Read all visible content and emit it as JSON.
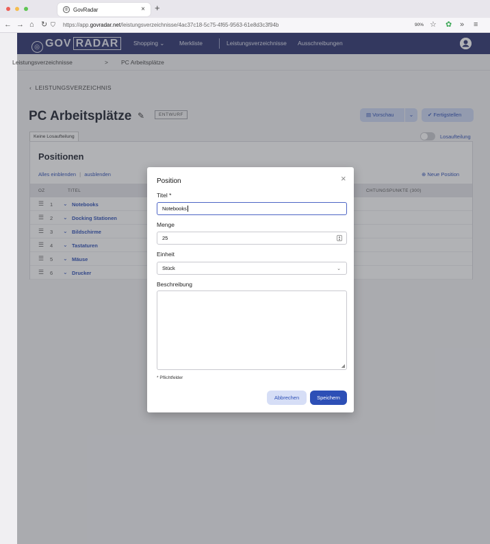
{
  "browser": {
    "tab_title": "GovRadar",
    "tab_close": "×",
    "new_tab": "+",
    "url_prefix": "https://app.",
    "url_host": "govradar.net",
    "url_path": "/leistungsverzeichnisse/4ac37c18-5c75-4f65-9563-61e8d3c3f94b",
    "zoom": "90%"
  },
  "nav": {
    "logo_left": "GOV",
    "logo_right": "RADAR",
    "shopping": "Shopping",
    "merkliste": "Merkliste",
    "leistungsverzeichnisse": "Leistungsverzeichnisse",
    "ausschreibungen": "Ausschreibungen"
  },
  "breadcrumb": {
    "root": "Leistungsverzeichnisse",
    "sep": ">",
    "current": "PC Arbeitsplätze"
  },
  "page": {
    "back_link": "LEISTUNGSVERZEICHNIS",
    "title": "PC Arbeitsplätze",
    "status_badge": "ENTWURF",
    "preview_button": "Vorschau",
    "finish_button": "Fertigstellen",
    "lot_tab": "Keine Losaufteilung",
    "lot_toggle_label": "Losaufteilung"
  },
  "positions": {
    "heading": "Positionen",
    "show_all": "Alles einblenden",
    "divider": "|",
    "hide_all": "ausblenden",
    "new_position": "Neue Position",
    "col_oz": "OZ",
    "col_title": "TITEL",
    "col_points": "CHTUNGSPUNKTE (300)",
    "rows": [
      {
        "oz": "1",
        "title": "Notebooks"
      },
      {
        "oz": "2",
        "title": "Docking Stationen"
      },
      {
        "oz": "3",
        "title": "Bildschirme"
      },
      {
        "oz": "4",
        "title": "Tastaturen"
      },
      {
        "oz": "5",
        "title": "Mäuse"
      },
      {
        "oz": "6",
        "title": "Drucker"
      }
    ]
  },
  "modal": {
    "title": "Position",
    "close": "×",
    "titel_label": "Titel *",
    "titel_value": "Notebooks",
    "menge_label": "Menge",
    "menge_value": "25",
    "einheit_label": "Einheit",
    "einheit_value": "Stück",
    "beschreibung_label": "Beschreibung",
    "beschreibung_value": "",
    "required_note": "* Pflichtfelder",
    "cancel": "Abbrechen",
    "save": "Speichern"
  },
  "colors": {
    "nav_bg": "#2d3570",
    "primary": "#2d4fb6",
    "primary_light": "#cdd9f5",
    "traffic_red": "#ed5f57",
    "traffic_yellow": "#f5bd4f",
    "traffic_green": "#5fc553"
  }
}
